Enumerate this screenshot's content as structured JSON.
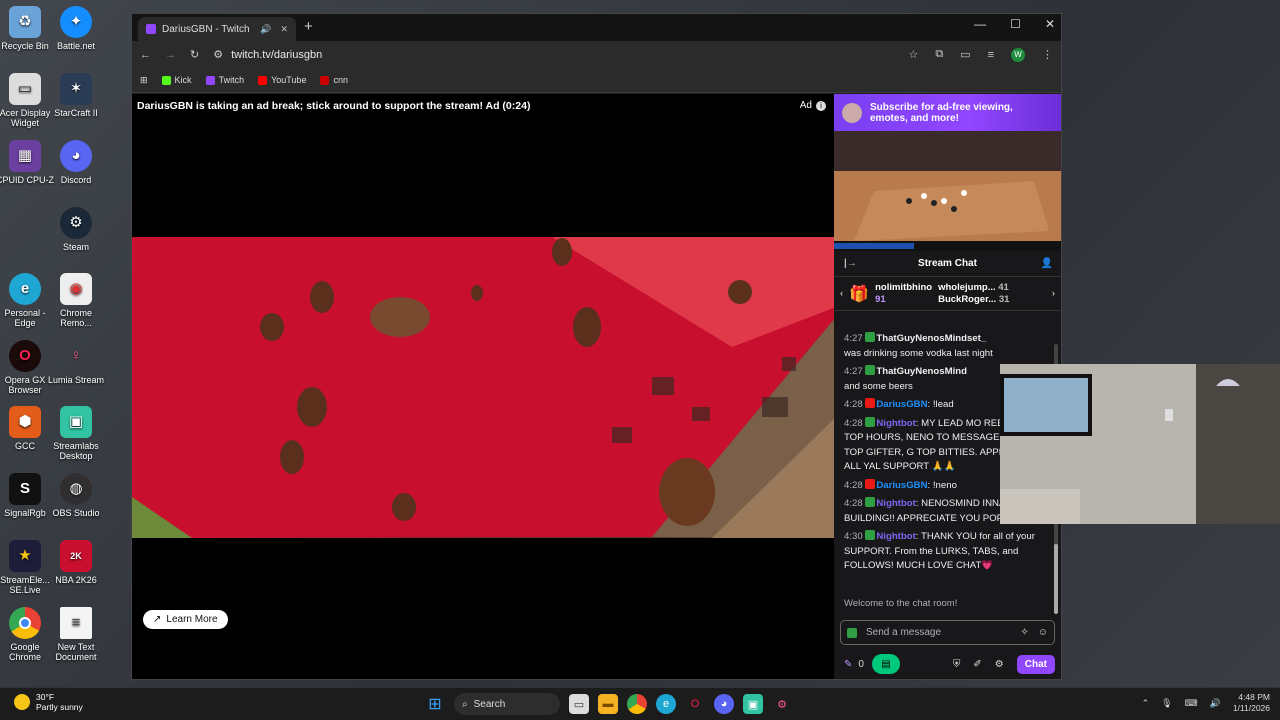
{
  "desktop": {
    "icons": [
      {
        "label": "Recycle Bin",
        "icon": "recycle-bin-icon"
      },
      {
        "label": "Battle.net",
        "icon": "battlenet-icon"
      },
      {
        "label": "Acer Display Widget",
        "icon": "acer-icon"
      },
      {
        "label": "StarCraft II",
        "icon": "starcraft-icon"
      },
      {
        "label": "CPUID CPU-Z",
        "icon": "cpuz-icon"
      },
      {
        "label": "Discord",
        "icon": "discord-icon"
      },
      {
        "label": "Steam",
        "icon": "steam-icon"
      },
      {
        "label": "Personal - Edge",
        "icon": "edge-icon"
      },
      {
        "label": "Chrome Remo...",
        "icon": "chrome-remote-icon"
      },
      {
        "label": "Opera GX Browser",
        "icon": "opera-icon"
      },
      {
        "label": "Lumia Stream",
        "icon": "lumia-icon"
      },
      {
        "label": "GCC",
        "icon": "gcc-icon"
      },
      {
        "label": "Streamlabs Desktop",
        "icon": "streamlabs-icon"
      },
      {
        "label": "SignalRgb",
        "icon": "signalrgb-icon"
      },
      {
        "label": "OBS Studio",
        "icon": "obs-icon"
      },
      {
        "label": "StreamEle... SE.Live",
        "icon": "streamelements-icon"
      },
      {
        "label": "NBA 2K26",
        "icon": "nba2k-icon"
      },
      {
        "label": "Google Chrome",
        "icon": "chrome-icon"
      },
      {
        "label": "New Text Document",
        "icon": "text-document-icon"
      }
    ]
  },
  "browser": {
    "tab_title": "DariusGBN - Twitch",
    "url": "twitch.tv/dariusgbn",
    "bookmarks": [
      "Kick",
      "Twitch",
      "YouTube",
      "cnn"
    ]
  },
  "player": {
    "ad_text": "DariusGBN is taking an ad break; stick around to support the stream! Ad (0:24)",
    "ad_label": "Ad",
    "learn_more": "Learn More"
  },
  "side": {
    "subscribe_banner": "Subscribe for ad-free viewing, emotes, and more!",
    "chat_title": "Stream Chat",
    "gifters": [
      {
        "name": "nolimitbhino",
        "count": "91"
      },
      {
        "name": "wholejump...",
        "count": "41"
      },
      {
        "name": "BuckRoger...",
        "count": "31"
      }
    ],
    "messages": [
      {
        "time": "4:27",
        "user": "ThatGuyNenosMindset_",
        "text": "was drinking some vodka last night",
        "color": "#ffffff"
      },
      {
        "time": "4:27",
        "user": "ThatGuyNenosMind",
        "text": "and some beers",
        "color": "#ffffff"
      },
      {
        "time": "4:28",
        "user": "DariusGBN",
        "text": "!lead",
        "color": "#1e90ff"
      },
      {
        "time": "4:28",
        "user": "Nightbot",
        "text": "MY LEAD MO REBOUNDS TOP HOURS, NENO TO MESSAGES, BHINO TOP GIFTER, G TOP BITTIES. APPRECIATE ALL YAL SUPPORT 🙏🙏",
        "color": "#7b68ee"
      },
      {
        "time": "4:28",
        "user": "DariusGBN",
        "text": "!neno",
        "color": "#1e90ff"
      },
      {
        "time": "4:28",
        "user": "Nightbot",
        "text": "NENOSMIND INNA BUILDING!! APPRECIATE YOU POP",
        "color": "#7b68ee"
      },
      {
        "time": "4:30",
        "user": "Nightbot",
        "text": "THANK YOU for all of your SUPPORT. From the LURKS, TABS, and FOLLOWS! MUCH LOVE CHAT💗",
        "color": "#7b68ee"
      }
    ],
    "welcome": "Welcome to the chat room!",
    "input_placeholder": "Send a message",
    "points": "0",
    "chat_button": "Chat"
  },
  "taskbar": {
    "temp": "30°F",
    "weather": "Partly sunny",
    "search": "Search",
    "time": "4:48 PM",
    "date": "1/11/2026"
  }
}
